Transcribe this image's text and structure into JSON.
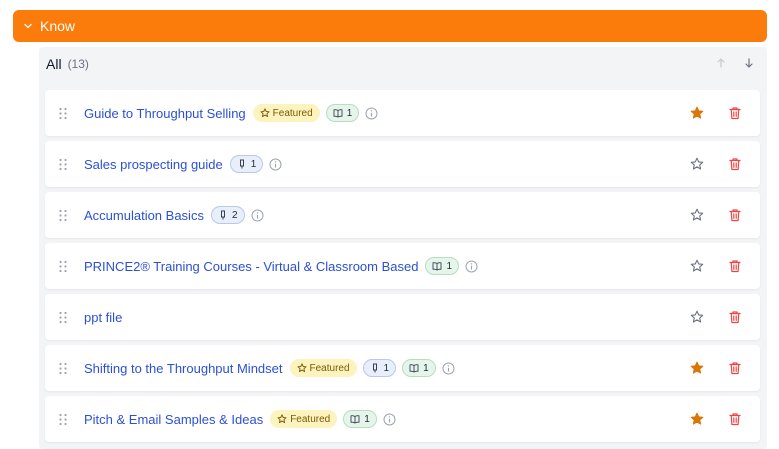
{
  "section": {
    "title": "Know"
  },
  "list": {
    "all_label": "All",
    "count_label": "(13)"
  },
  "featured_label": "Featured",
  "colors": {
    "header_bg": "#fb7c0a",
    "link": "#2b50d6",
    "star_filled": "#d97706",
    "trash": "#ef4444"
  },
  "items": [
    {
      "title": "Guide to Throughput Selling",
      "featured": true,
      "starred": true,
      "blue_count": null,
      "green_count": "1",
      "info": true
    },
    {
      "title": "Sales prospecting guide",
      "featured": false,
      "starred": false,
      "blue_count": "1",
      "green_count": null,
      "info": true
    },
    {
      "title": "Accumulation Basics",
      "featured": false,
      "starred": false,
      "blue_count": "2",
      "green_count": null,
      "info": true
    },
    {
      "title": "PRINCE2® Training Courses - Virtual & Classroom Based",
      "featured": false,
      "starred": false,
      "blue_count": null,
      "green_count": "1",
      "info": true
    },
    {
      "title": "ppt file",
      "featured": false,
      "starred": false,
      "blue_count": null,
      "green_count": null,
      "info": false
    },
    {
      "title": "Shifting to the Throughput Mindset",
      "featured": true,
      "starred": true,
      "blue_count": "1",
      "green_count": "1",
      "info": true
    },
    {
      "title": "Pitch & Email Samples & Ideas",
      "featured": true,
      "starred": true,
      "blue_count": null,
      "green_count": "1",
      "info": true
    }
  ]
}
